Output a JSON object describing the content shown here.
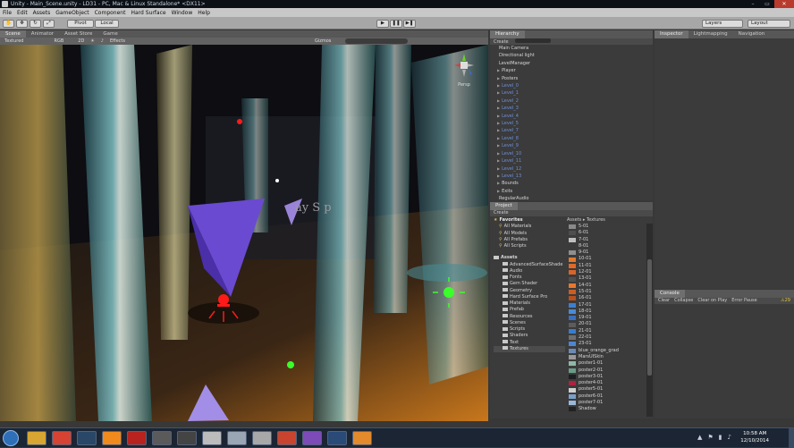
{
  "window": {
    "title": "Unity - Main_Scene.unity - LD31 - PC, Mac & Linux Standalone* <DX11>",
    "controls": [
      "–",
      "▭",
      "✕"
    ]
  },
  "menu": [
    "File",
    "Edit",
    "Assets",
    "GameObject",
    "Component",
    "Hard Surface",
    "Window",
    "Help"
  ],
  "toolbar": {
    "pivot": "Pivot",
    "local": "Local",
    "play": "▶",
    "pause": "❚❚",
    "step": "▶❚",
    "layers": "Layers",
    "layout": "Layout"
  },
  "tabs": {
    "scene": "Scene",
    "animator": "Animator",
    "asset_store": "Asset Store",
    "game": "Game"
  },
  "scene_toolbar": {
    "shading": "Textured",
    "render": "RGB",
    "mode2d": "2D",
    "effects": "Effects",
    "gizmos": "Gizmos",
    "persp": "Persp"
  },
  "scene_text": "ay S   p",
  "hierarchy": {
    "title": "Hierarchy",
    "create": "Create",
    "items": [
      {
        "label": "Main Camera",
        "blue": false,
        "expand": false
      },
      {
        "label": "Directional light",
        "blue": false,
        "expand": false
      },
      {
        "label": "LevelManager",
        "blue": false,
        "expand": false
      },
      {
        "label": "Player",
        "blue": false,
        "expand": true
      },
      {
        "label": "Posters",
        "blue": false,
        "expand": true
      },
      {
        "label": "Level_0",
        "blue": true,
        "expand": true
      },
      {
        "label": "Level_1",
        "blue": true,
        "expand": true
      },
      {
        "label": "Level_2",
        "blue": true,
        "expand": true
      },
      {
        "label": "Level_3",
        "blue": true,
        "expand": true
      },
      {
        "label": "Level_4",
        "blue": true,
        "expand": true
      },
      {
        "label": "Level_5",
        "blue": true,
        "expand": true
      },
      {
        "label": "Level_7",
        "blue": true,
        "expand": true
      },
      {
        "label": "Level_8",
        "blue": true,
        "expand": true
      },
      {
        "label": "Level_9",
        "blue": true,
        "expand": true
      },
      {
        "label": "Level_10",
        "blue": true,
        "expand": true
      },
      {
        "label": "Level_11",
        "blue": true,
        "expand": true
      },
      {
        "label": "Level_12",
        "blue": true,
        "expand": true
      },
      {
        "label": "Level_13",
        "blue": true,
        "expand": true
      },
      {
        "label": "Bounds",
        "blue": false,
        "expand": true
      },
      {
        "label": "Exits",
        "blue": false,
        "expand": true
      },
      {
        "label": "RegularAudio",
        "blue": false,
        "expand": false
      }
    ]
  },
  "inspector": {
    "tabs": [
      "Inspector",
      "Lightmapping",
      "Navigation"
    ]
  },
  "project": {
    "title": "Project",
    "create": "Create",
    "breadcrumb": "Assets ▸ Textures",
    "favorites": {
      "label": "Favorites",
      "items": [
        "All Materials",
        "All Models",
        "All Prefabs",
        "All Scripts"
      ]
    },
    "assets": {
      "label": "Assets",
      "items": [
        "AdvancedSurfaceShade",
        "Audio",
        "Fonts",
        "Gem Shader",
        "Geometry",
        "Hard Surface Pro",
        "Materials",
        "Prefab",
        "Resources",
        "Scenes",
        "Scripts",
        "Shaders",
        "Text",
        "Textures"
      ]
    },
    "files": [
      {
        "name": "5-01",
        "color": "#8a8a8a"
      },
      {
        "name": "6-01",
        "color": "#4e4e4e"
      },
      {
        "name": "7-01",
        "color": "#bfbfbf"
      },
      {
        "name": "8-01",
        "color": "#3a3a3a"
      },
      {
        "name": "9-01",
        "color": "#8f8f8f"
      },
      {
        "name": "10-01",
        "color": "#e07a2e"
      },
      {
        "name": "11-01",
        "color": "#e06a26"
      },
      {
        "name": "12-01",
        "color": "#d9642a"
      },
      {
        "name": "13-01",
        "color": "#4f4f4f"
      },
      {
        "name": "14-01",
        "color": "#e8782c"
      },
      {
        "name": "15-01",
        "color": "#c95f24"
      },
      {
        "name": "16-01",
        "color": "#b8501e"
      },
      {
        "name": "17-01",
        "color": "#3c7fd0"
      },
      {
        "name": "18-01",
        "color": "#4a8ad6"
      },
      {
        "name": "19-01",
        "color": "#3a6fbf"
      },
      {
        "name": "20-01",
        "color": "#5c5c5c"
      },
      {
        "name": "21-01",
        "color": "#3a7ccc"
      },
      {
        "name": "22-01",
        "color": "#6e6e6e"
      },
      {
        "name": "23-01",
        "color": "#4e86d0"
      },
      {
        "name": "blue_orange_grad",
        "color": "#6a8bb8"
      },
      {
        "name": "MarsUISkin",
        "color": "#999999"
      },
      {
        "name": "poster1-01",
        "color": "#8fb8a6"
      },
      {
        "name": "poster2-01",
        "color": "#6a9c8a"
      },
      {
        "name": "poster3-01",
        "color": "#1e1e1e"
      },
      {
        "name": "poster4-01",
        "color": "#b02040"
      },
      {
        "name": "poster5-01",
        "color": "#cfcfcf"
      },
      {
        "name": "poster6-01",
        "color": "#7aa0c8"
      },
      {
        "name": "poster7-01",
        "color": "#9ab8d8"
      },
      {
        "name": "Shadow",
        "color": "#222222"
      }
    ]
  },
  "console": {
    "title": "Console",
    "buttons": [
      "Clear",
      "Collapse",
      "Clear on Play",
      "Error Pause"
    ],
    "warn_count": "29"
  },
  "taskbar": {
    "time": "10:58 AM",
    "date": "12/10/2014",
    "apps": [
      {
        "name": "explorer-icon",
        "color": "#d7a531"
      },
      {
        "name": "chrome-icon",
        "color": "#d64333"
      },
      {
        "name": "steam-icon",
        "color": "#2a4768"
      },
      {
        "name": "vlc-icon",
        "color": "#f08a1c"
      },
      {
        "name": "filezilla-icon",
        "color": "#b8231f"
      },
      {
        "name": "unity-icon",
        "color": "#5a5a5a"
      },
      {
        "name": "unity-pro-icon",
        "color": "#444444"
      },
      {
        "name": "grid-icon",
        "color": "#bcbcbc"
      },
      {
        "name": "tools-icon",
        "color": "#9aa6b4"
      },
      {
        "name": "cow-icon",
        "color": "#a8a8a8"
      },
      {
        "name": "git-icon",
        "color": "#c8442f"
      },
      {
        "name": "visual-studio-icon",
        "color": "#7c4bb8"
      },
      {
        "name": "photoshop-icon",
        "color": "#2a4a78"
      },
      {
        "name": "sublime-icon",
        "color": "#e28a2c"
      }
    ]
  }
}
